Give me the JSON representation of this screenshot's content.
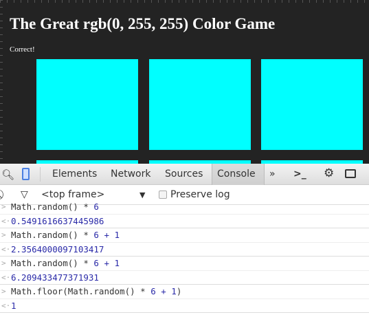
{
  "game": {
    "title": "The Great rgb(0, 255, 255) Color Game",
    "message": "Correct!",
    "square_color": "#00ffff",
    "background": "#232323"
  },
  "devtools": {
    "tabs": [
      "Elements",
      "Network",
      "Sources",
      "Console"
    ],
    "active_tab": "Console",
    "more": "»",
    "frame": "<top frame>",
    "preserve_log": "Preserve log",
    "preserve_log_checked": false
  },
  "console": [
    {
      "type": "in",
      "code": "Math.random() * ",
      "num": "6"
    },
    {
      "type": "out",
      "text": "0.5491616637445986"
    },
    {
      "type": "in",
      "code": "Math.random() * ",
      "num": "6 + 1"
    },
    {
      "type": "out",
      "text": "2.3564000097103417"
    },
    {
      "type": "in",
      "code": "Math.random() * ",
      "num": "6 + 1"
    },
    {
      "type": "out",
      "text": "6.209433477371931"
    },
    {
      "type": "in",
      "code": "Math.floor(Math.random() * ",
      "num": "6 + 1",
      "tail": ")"
    },
    {
      "type": "out",
      "text": "1"
    }
  ]
}
